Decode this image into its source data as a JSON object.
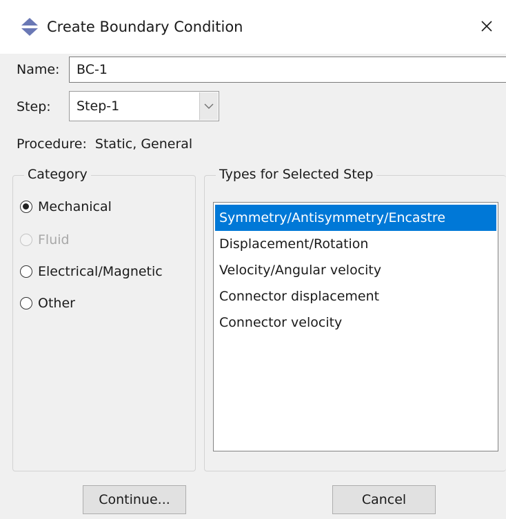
{
  "window": {
    "title": "Create Boundary Condition",
    "close_glyph": "✕"
  },
  "name_field": {
    "label": "Name:",
    "value": "BC-1"
  },
  "step_field": {
    "label": "Step:",
    "value": "Step-1"
  },
  "procedure": {
    "label": "Procedure:",
    "value": "Static, General"
  },
  "category": {
    "title": "Category",
    "options": [
      {
        "label": "Mechanical",
        "checked": true,
        "enabled": true
      },
      {
        "label": "Fluid",
        "checked": false,
        "enabled": false
      },
      {
        "label": "Electrical/Magnetic",
        "checked": false,
        "enabled": true
      },
      {
        "label": "Other",
        "checked": false,
        "enabled": true
      }
    ]
  },
  "types": {
    "title": "Types for Selected Step",
    "items": [
      {
        "label": "Symmetry/Antisymmetry/Encastre",
        "selected": true
      },
      {
        "label": "Displacement/Rotation",
        "selected": false
      },
      {
        "label": "Velocity/Angular velocity",
        "selected": false
      },
      {
        "label": "Connector displacement",
        "selected": false
      },
      {
        "label": "Connector velocity",
        "selected": false
      }
    ]
  },
  "buttons": {
    "continue_label": "Continue...",
    "cancel_label": "Cancel"
  },
  "colors": {
    "selection": "#0078d7",
    "background": "#f0f0f0",
    "icon_blue": "#6a78b5"
  },
  "icons": {
    "title_icon": "abaqus-boundary-condition-icon",
    "dropdown_icon": "chevron-down-icon",
    "close_icon": "close-icon"
  }
}
